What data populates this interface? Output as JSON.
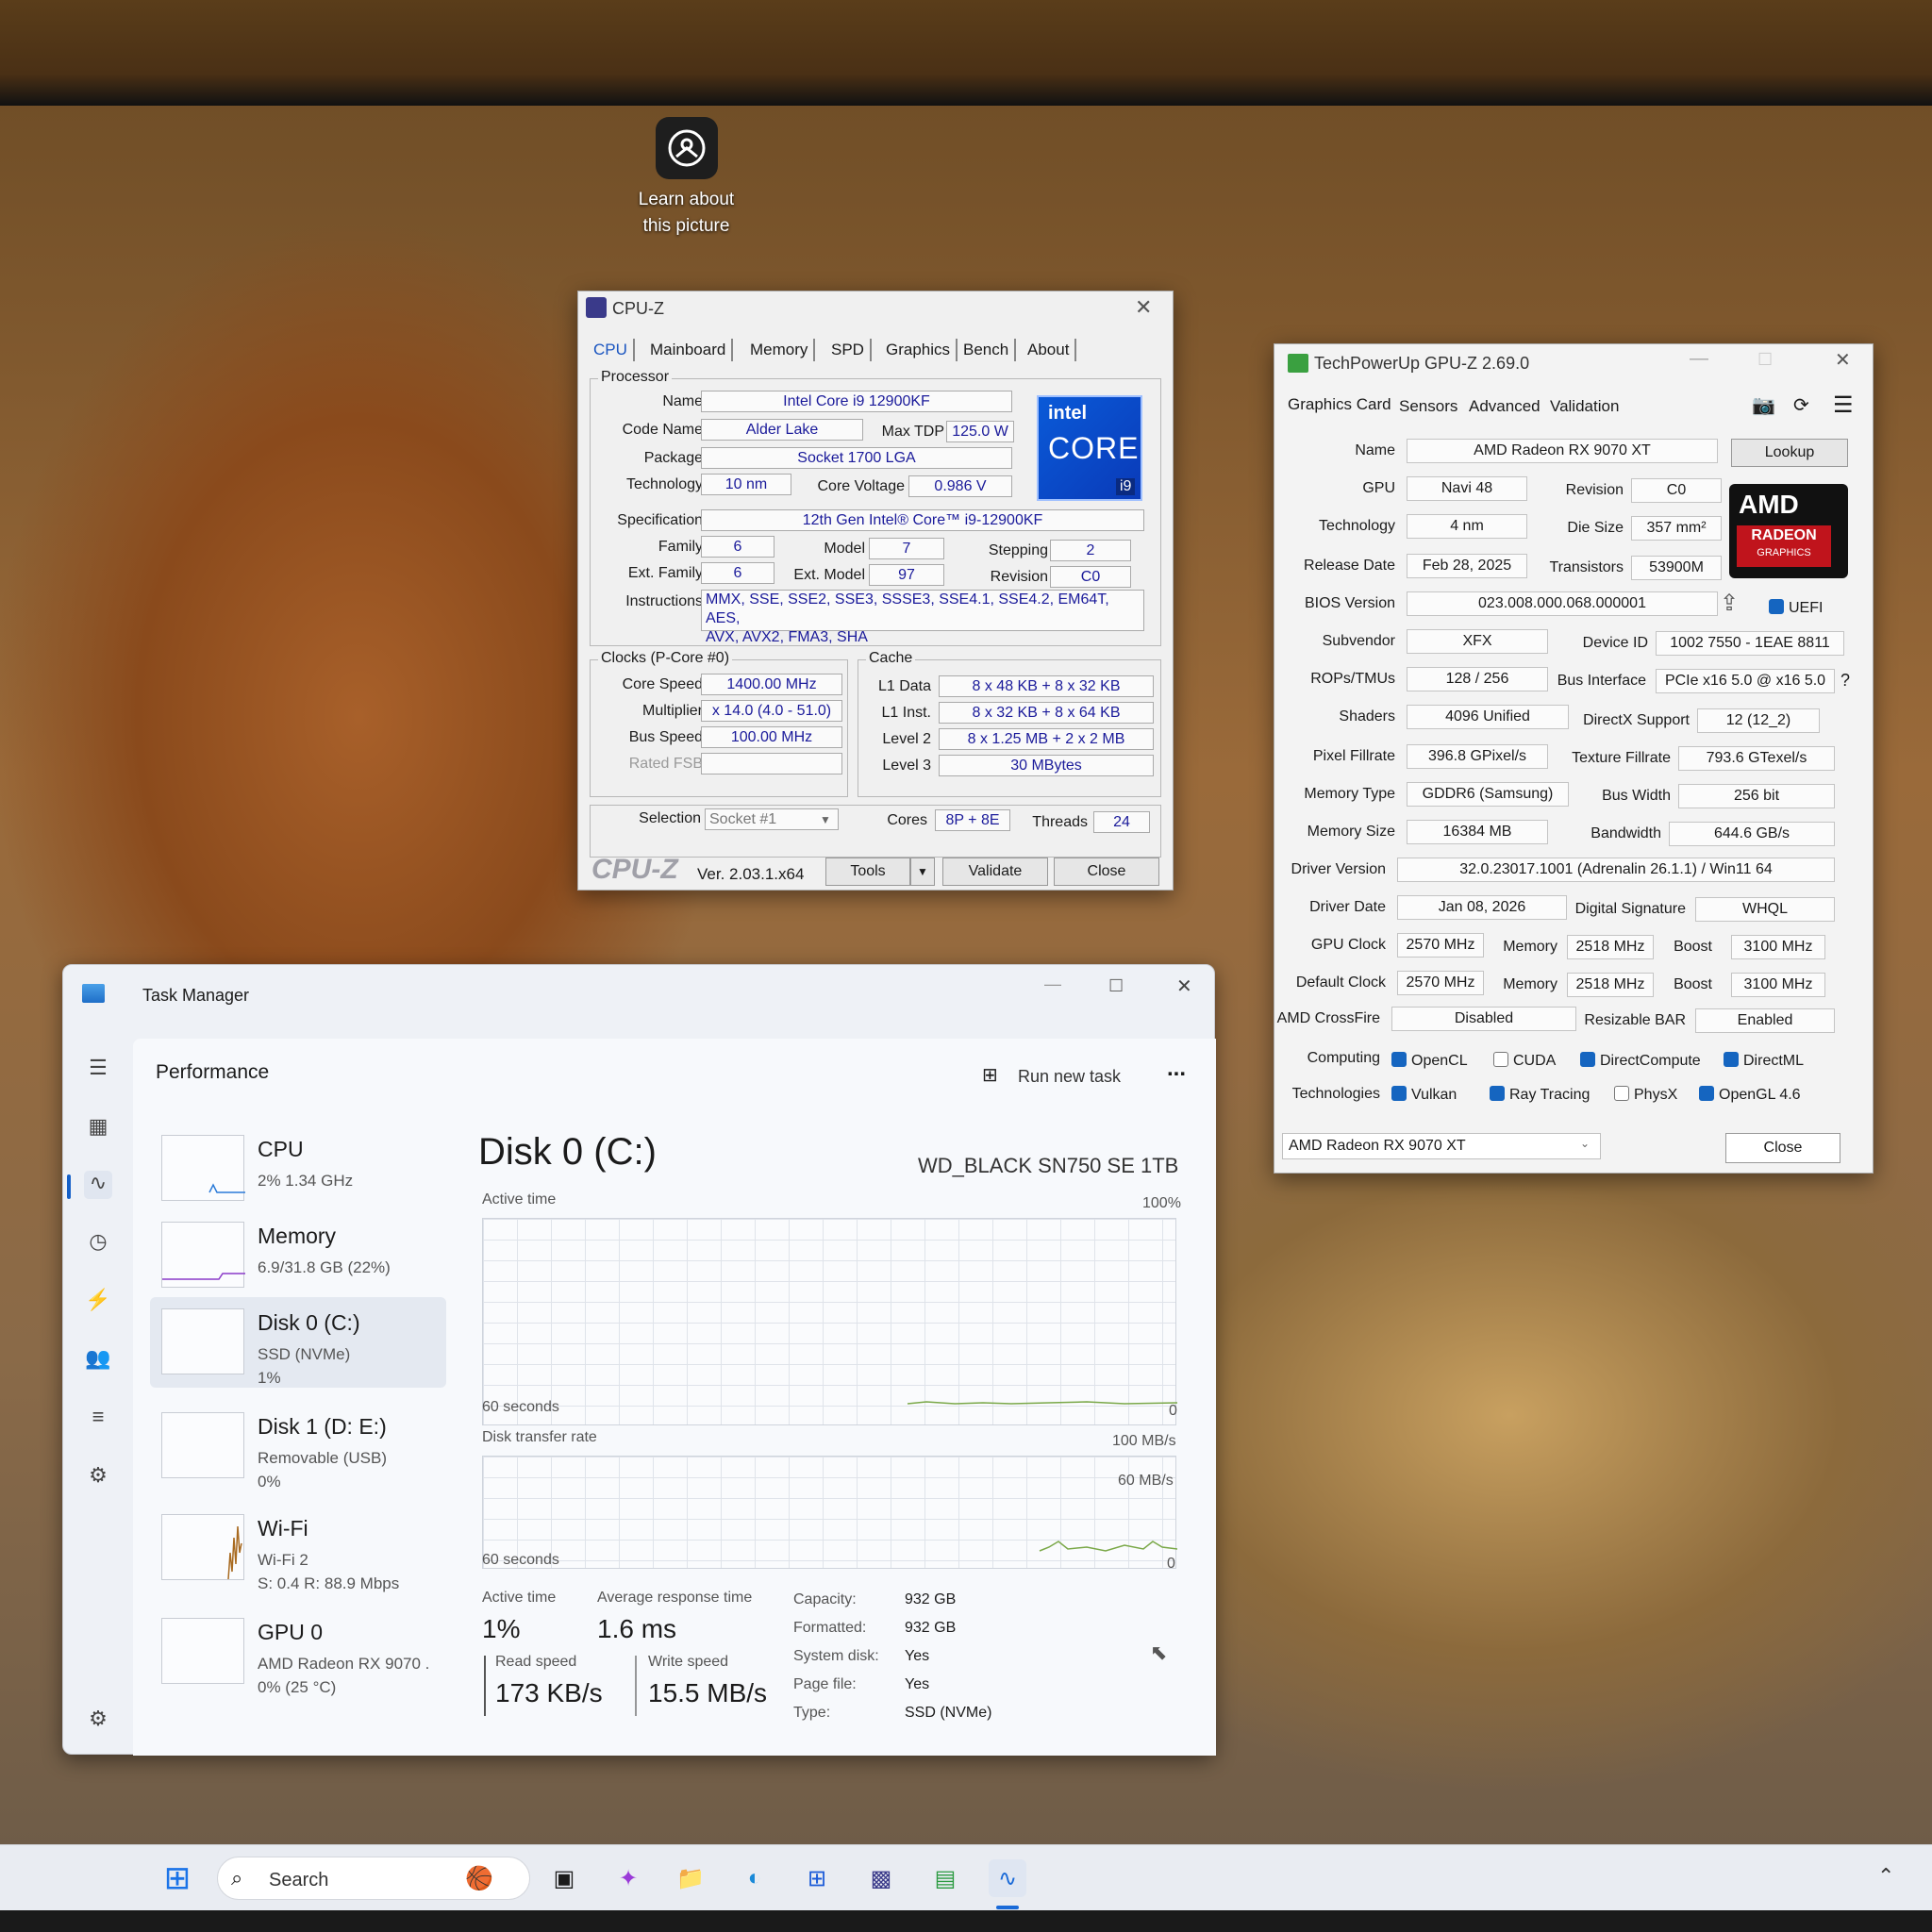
{
  "desktop": {
    "icon_label_1": "Learn about",
    "icon_label_2": "this picture"
  },
  "cpuz": {
    "title": "CPU-Z",
    "tabs": [
      "CPU",
      "Mainboard",
      "Memory",
      "SPD",
      "Graphics",
      "Bench",
      "About"
    ],
    "processor_legend": "Processor",
    "name_label": "Name",
    "name": "Intel Core i9 12900KF",
    "codename_label": "Code Name",
    "codename": "Alder Lake",
    "maxtdp_label": "Max TDP",
    "maxtdp": "125.0 W",
    "package_label": "Package",
    "package": "Socket 1700 LGA",
    "technology_label": "Technology",
    "technology": "10 nm",
    "corevoltage_label": "Core Voltage",
    "corevoltage": "0.986 V",
    "spec_label": "Specification",
    "spec": "12th Gen Intel® Core™ i9-12900KF",
    "family_label": "Family",
    "family": "6",
    "model_label": "Model",
    "model": "7",
    "stepping_label": "Stepping",
    "stepping": "2",
    "extfamily_label": "Ext. Family",
    "extfamily": "6",
    "extmodel_label": "Ext. Model",
    "extmodel": "97",
    "revision_label": "Revision",
    "revision": "C0",
    "instructions_label": "Instructions",
    "instructions_1": "MMX, SSE, SSE2, SSE3, SSSE3, SSE4.1, SSE4.2, EM64T, AES,",
    "instructions_2": "AVX, AVX2, FMA3, SHA",
    "logo_brand": "intel",
    "logo_core": "CORE",
    "logo_tier": "i9",
    "clocks_legend": "Clocks (P-Core #0)",
    "corespeed_label": "Core Speed",
    "corespeed": "1400.00 MHz",
    "multiplier_label": "Multiplier",
    "multiplier": "x 14.0 (4.0 - 51.0)",
    "busspeed_label": "Bus Speed",
    "busspeed": "100.00 MHz",
    "ratedfsb_label": "Rated FSB",
    "ratedfsb": "",
    "cache_legend": "Cache",
    "l1data_label": "L1 Data",
    "l1data": "8 x 48 KB + 8 x 32 KB",
    "l1inst_label": "L1 Inst.",
    "l1inst": "8 x 32 KB + 8 x 64 KB",
    "level2_label": "Level 2",
    "level2": "8 x 1.25 MB + 2 x 2 MB",
    "level3_label": "Level 3",
    "level3": "30 MBytes",
    "selection_label": "Selection",
    "selection": "Socket #1",
    "cores_label": "Cores",
    "cores": "8P + 8E",
    "threads_label": "Threads",
    "threads": "24",
    "brand": "CPU-Z",
    "version": "Ver. 2.03.1.x64",
    "tools": "Tools",
    "validate": "Validate",
    "close": "Close"
  },
  "gpuz": {
    "title": "TechPowerUp GPU-Z 2.69.0",
    "tabs": [
      "Graphics Card",
      "Sensors",
      "Advanced",
      "Validation"
    ],
    "name_label": "Name",
    "name": "AMD Radeon RX 9070 XT",
    "lookup": "Lookup",
    "gpu_label": "GPU",
    "gpu": "Navi 48",
    "revision_label": "Revision",
    "revision": "C0",
    "technology_label": "Technology",
    "technology": "4 nm",
    "diesize_label": "Die Size",
    "diesize": "357 mm²",
    "releasedate_label": "Release Date",
    "releasedate": "Feb 28, 2025",
    "transistors_label": "Transistors",
    "transistors": "53900M",
    "bios_label": "BIOS Version",
    "bios": "023.008.000.068.000001",
    "uefi": "UEFI",
    "subvendor_label": "Subvendor",
    "subvendor": "XFX",
    "deviceid_label": "Device ID",
    "deviceid": "1002 7550 - 1EAE 8811",
    "rops_label": "ROPs/TMUs",
    "rops": "128 / 256",
    "businterface_label": "Bus Interface",
    "businterface": "PCIe x16 5.0 @ x16 5.0",
    "help": "?",
    "shaders_label": "Shaders",
    "shaders": "4096 Unified",
    "directx_label": "DirectX Support",
    "directx": "12 (12_2)",
    "pixelfill_label": "Pixel Fillrate",
    "pixelfill": "396.8 GPixel/s",
    "texturefill_label": "Texture Fillrate",
    "texturefill": "793.6 GTexel/s",
    "memtype_label": "Memory Type",
    "memtype": "GDDR6 (Samsung)",
    "buswidth_label": "Bus Width",
    "buswidth": "256 bit",
    "memsize_label": "Memory Size",
    "memsize": "16384 MB",
    "bandwidth_label": "Bandwidth",
    "bandwidth": "644.6 GB/s",
    "driver_label": "Driver Version",
    "driver": "32.0.23017.1001 (Adrenalin 26.1.1) / Win11 64",
    "driverdate_label": "Driver Date",
    "driverdate": "Jan 08, 2026",
    "digsig_label": "Digital Signature",
    "digsig": "WHQL",
    "gpuclock_label": "GPU Clock",
    "gpuclock": "2570 MHz",
    "memory_label": "Memory",
    "gpumem": "2518 MHz",
    "boost_label": "Boost",
    "gpuboost": "3100 MHz",
    "defclock_label": "Default Clock",
    "defclock": "2570 MHz",
    "defmem": "2518 MHz",
    "defboost": "3100 MHz",
    "crossfire_label": "AMD CrossFire",
    "crossfire": "Disabled",
    "rebar_label": "Resizable BAR",
    "rebar": "Enabled",
    "computing_label": "Computing",
    "technologies_label": "Technologies",
    "computing": [
      {
        "label": "OpenCL",
        "on": true
      },
      {
        "label": "CUDA",
        "on": false
      },
      {
        "label": "DirectCompute",
        "on": true
      },
      {
        "label": "DirectML",
        "on": true
      }
    ],
    "techs": [
      {
        "label": "Vulkan",
        "on": true
      },
      {
        "label": "Ray Tracing",
        "on": true
      },
      {
        "label": "PhysX",
        "on": false
      },
      {
        "label": "OpenGL 4.6",
        "on": true
      }
    ],
    "select": "AMD Radeon RX 9070 XT",
    "close": "Close",
    "amd_logo": "AMD",
    "radeon": "RADEON",
    "graphics": "GRAPHICS"
  },
  "taskmanager": {
    "title": "Task Manager",
    "section": "Performance",
    "run_new_task": "Run new task",
    "more": "...",
    "items": [
      {
        "name": "CPU",
        "l1": "2% 1.34 GHz",
        "l2": "",
        "l3": ""
      },
      {
        "name": "Memory",
        "l1": "6.9/31.8 GB (22%)",
        "l2": "",
        "l3": ""
      },
      {
        "name": "Disk 0 (C:)",
        "l1": "SSD (NVMe)",
        "l2": "1%",
        "l3": ""
      },
      {
        "name": "Disk 1 (D: E:)",
        "l1": "Removable (USB)",
        "l2": "0%",
        "l3": ""
      },
      {
        "name": "Wi-Fi",
        "l1": "Wi-Fi 2",
        "l2": "S: 0.4 R: 88.9 Mbps",
        "l3": ""
      },
      {
        "name": "GPU 0",
        "l1": "AMD Radeon RX 9070 .",
        "l2": "0% (25 °C)",
        "l3": ""
      }
    ],
    "disk_title": "Disk 0 (C:)",
    "disk_model": "WD_BLACK SN750 SE 1TB",
    "active_time_label": "Active time",
    "pct100": "100%",
    "sixty1": "60 seconds",
    "zero1": "0",
    "transfer_label": "Disk transfer rate",
    "mb100": "100 MB/s",
    "mb60": "60 MB/s",
    "sixty2": "60 seconds",
    "zero2": "0",
    "stat_active_label": "Active time",
    "stat_active": "1%",
    "stat_resp_label": "Average response time",
    "stat_resp": "1.6 ms",
    "read_label": "Read speed",
    "read": "173 KB/s",
    "write_label": "Write speed",
    "write": "15.5 MB/s",
    "capacity_label": "Capacity:",
    "capacity": "932 GB",
    "formatted_label": "Formatted:",
    "formatted": "932 GB",
    "sysdisk_label": "System disk:",
    "sysdisk": "Yes",
    "pagefile_label": "Page file:",
    "pagefile": "Yes",
    "type_label": "Type:",
    "type": "SSD (NVMe)"
  },
  "taskbar": {
    "search": "Search"
  }
}
